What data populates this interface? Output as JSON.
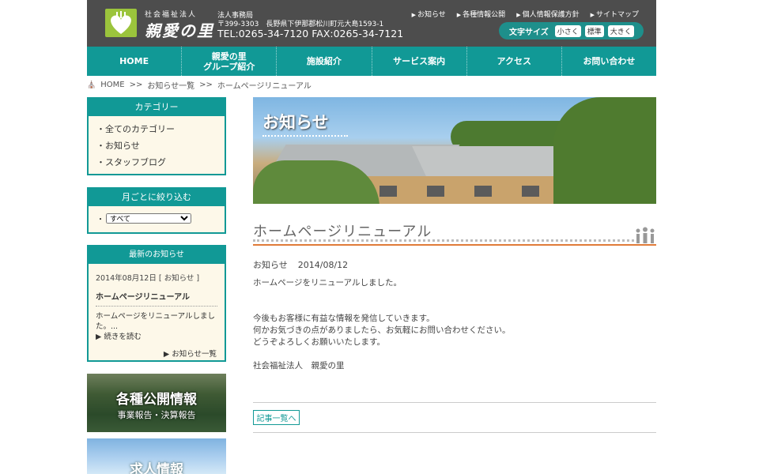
{
  "header": {
    "logo_sub": "社会福祉法人",
    "logo_main": "親愛の里",
    "office_name": "法人事務局",
    "office_address": "〒399-3303　長野県下伊那郡松川町元大島1593-1",
    "office_tel": "TEL:0265-34-7120 FAX:0265-34-7121",
    "top_links": [
      "お知らせ",
      "各種情報公開",
      "個人情報保護方針",
      "サイトマップ"
    ],
    "font_size_label": "文字サイズ",
    "font_sizes": [
      "小さく",
      "標準",
      "大きく"
    ]
  },
  "nav": {
    "items": [
      {
        "line1": "HOME",
        "line2": ""
      },
      {
        "line1": "親愛の里",
        "line2": "グループ紹介"
      },
      {
        "line1": "施設紹介",
        "line2": ""
      },
      {
        "line1": "サービス案内",
        "line2": ""
      },
      {
        "line1": "アクセス",
        "line2": ""
      },
      {
        "line1": "お問い合わせ",
        "line2": ""
      }
    ]
  },
  "breadcrumb": {
    "home": "HOME",
    "sep": ">>",
    "news_list": "お知らせ一覧",
    "current": "ホームページリニューアル"
  },
  "sidebar": {
    "category_title": "カテゴリー",
    "categories": [
      "全てのカテゴリー",
      "お知らせ",
      "スタッフブログ"
    ],
    "month_title": "月ごとに絞り込む",
    "month_bullet": "・",
    "month_selected": "すべて",
    "latest_title": "最新のお知らせ",
    "latest_date": "2014年08月12日 [ お知らせ ]",
    "latest_post_title": "ホームページリニューアル",
    "latest_excerpt": "ホームページをリニューアルしました。...",
    "read_more": "続きを読む",
    "news_list_link": "お知らせ一覧",
    "banner_disclosure_title": "各種公開情報",
    "banner_disclosure_sub": "事業報告・決算報告",
    "banner_recruit_title": "求人情報"
  },
  "main": {
    "hero_title": "お知らせ",
    "post_title": "ホームページリニューアル",
    "post_category": "お知らせ",
    "post_date": "2014/08/12",
    "post_body": [
      "ホームページをリニューアルしました。",
      "",
      "",
      "今後もお客様に有益な情報を発信していきます。",
      "何かお気づきの点がありましたら、お気軽にお問い合わせください。",
      "どうぞよろしくお願いいたします。",
      "",
      "社会福祉法人　親愛の里"
    ],
    "back_label": "記事一覧へ"
  },
  "colors": {
    "teal": "#119996",
    "header_bg": "#4d4d4d",
    "accent_orange": "#e07b39",
    "logo_green": "#9bc43c",
    "sidebar_bg": "#fdf8e9"
  }
}
